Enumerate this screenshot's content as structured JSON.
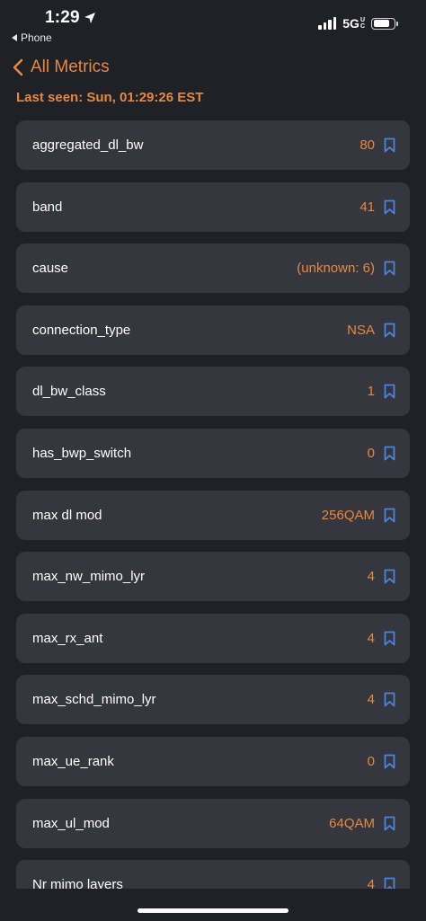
{
  "status_bar": {
    "time": "1:29",
    "back_app": "Phone",
    "network": "5G",
    "network_sup_top": "U",
    "network_sup_bottom": "C",
    "battery_level": 0.8
  },
  "nav": {
    "back_label": "All Metrics"
  },
  "header": {
    "last_seen": "Last seen: Sun, 01:29:26 EST"
  },
  "colors": {
    "accent": "#e48844",
    "bookmark": "#4a86e0",
    "row_background": "#36373e",
    "page_background": "#202126"
  },
  "metrics": [
    {
      "name": "aggregated_dl_bw",
      "value": "80"
    },
    {
      "name": "band",
      "value": "41"
    },
    {
      "name": "cause",
      "value": "(unknown: 6)"
    },
    {
      "name": "connection_type",
      "value": "NSA"
    },
    {
      "name": "dl_bw_class",
      "value": "1"
    },
    {
      "name": "has_bwp_switch",
      "value": "0"
    },
    {
      "name": "max dl mod",
      "value": "256QAM"
    },
    {
      "name": "max_nw_mimo_lyr",
      "value": "4"
    },
    {
      "name": "max_rx_ant",
      "value": "4"
    },
    {
      "name": "max_schd_mimo_lyr",
      "value": "4"
    },
    {
      "name": "max_ue_rank",
      "value": "0"
    },
    {
      "name": "max_ul_mod",
      "value": "64QAM"
    },
    {
      "name": "Nr mimo layers",
      "value": "4"
    }
  ]
}
